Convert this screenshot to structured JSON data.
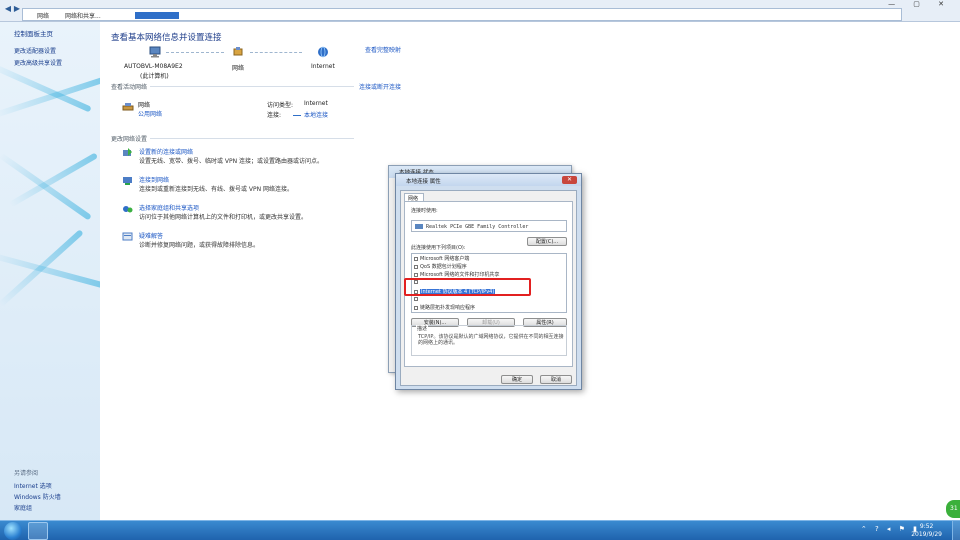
{
  "address_bar": {
    "segments": [
      "网络",
      "网络和共享..."
    ],
    "window_controls": "— ▢ ✕"
  },
  "left_pane": {
    "title": "控制面板主页",
    "links": [
      "更改适配器设置",
      "更改高级共享设置"
    ],
    "see_also_title": "另请参阅",
    "see_also": [
      "Internet 选项",
      "Windows 防火墙",
      "家庭组"
    ]
  },
  "main": {
    "title": "查看基本网络信息并设置连接",
    "full_map_link": "查看完整映射",
    "map": {
      "computer_name": "AUTOBVL-M08A9E2",
      "computer_sub": "(此计算机)",
      "network_label": "网络",
      "internet_label": "Internet"
    },
    "active_networks_label": "查看活动网络",
    "connect_disconnect_link": "连接或断开连接",
    "network": {
      "name": "网络",
      "type": "公用网络",
      "access_type_label": "访问类型:",
      "access_type_value": "Internet",
      "connection_label": "连接:",
      "connection_value": "本地连接"
    },
    "change_settings_label": "更改网络设置",
    "tasks": [
      {
        "title": "设置新的连接或网络",
        "desc": "设置无线、宽带、拨号、临时或 VPN 连接；或设置路由器或访问点。",
        "icon": "new-connection-icon"
      },
      {
        "title": "连接到网络",
        "desc": "连接到或重新连接到无线、有线、拨号或 VPN 网络连接。",
        "icon": "connect-network-icon"
      },
      {
        "title": "选择家庭组和共享选项",
        "desc": "访问位于其他网络计算机上的文件和打印机，或更改共享设置。",
        "icon": "homegroup-icon"
      },
      {
        "title": "疑难解答",
        "desc": "诊断并修复网络问题，或获得故障排除信息。",
        "icon": "troubleshoot-icon"
      }
    ]
  },
  "status_dialog": {
    "title": "本地连接 状态"
  },
  "properties_dialog": {
    "title": "本地连接 属性",
    "tab": "网络",
    "connect_using_label": "连接时使用:",
    "adapter": "Realtek PCIe GBE Family Controller",
    "configure_button": "配置(C)...",
    "items_label": "此连接使用下列项目(O):",
    "items": [
      {
        "label": "Microsoft 网络客户端",
        "selected": false
      },
      {
        "label": "QoS 数据包计划程序",
        "selected": false
      },
      {
        "label": "Microsoft 网络的文件和打印机共享",
        "selected": false
      },
      {
        "label": "",
        "selected": false
      },
      {
        "label": "Internet 协议版本 4 (TCP/IPv4)",
        "selected": true
      },
      {
        "label": "",
        "selected": false
      },
      {
        "label": "链路层拓扑发现响应程序",
        "selected": false
      }
    ],
    "install_button": "安装(N)...",
    "uninstall_button": "卸载(U)",
    "properties_button": "属性(R)",
    "description_label": "描述",
    "description": "TCP/IP。该协议是默认的广域网络协议，它提供在不同的相互连接的网络上的通讯。",
    "ok_button": "确定",
    "cancel_button": "取消"
  },
  "taskbar": {
    "time": "9:52",
    "date": "2019/9/29",
    "tray_icons": "⌃ ? ◂ ⚑ ▮"
  },
  "badge": "31",
  "colors": {
    "link": "#1a56c4",
    "title": "#1e3d8a",
    "highlight": "#e22020",
    "taskbar": "#1f63ad"
  }
}
